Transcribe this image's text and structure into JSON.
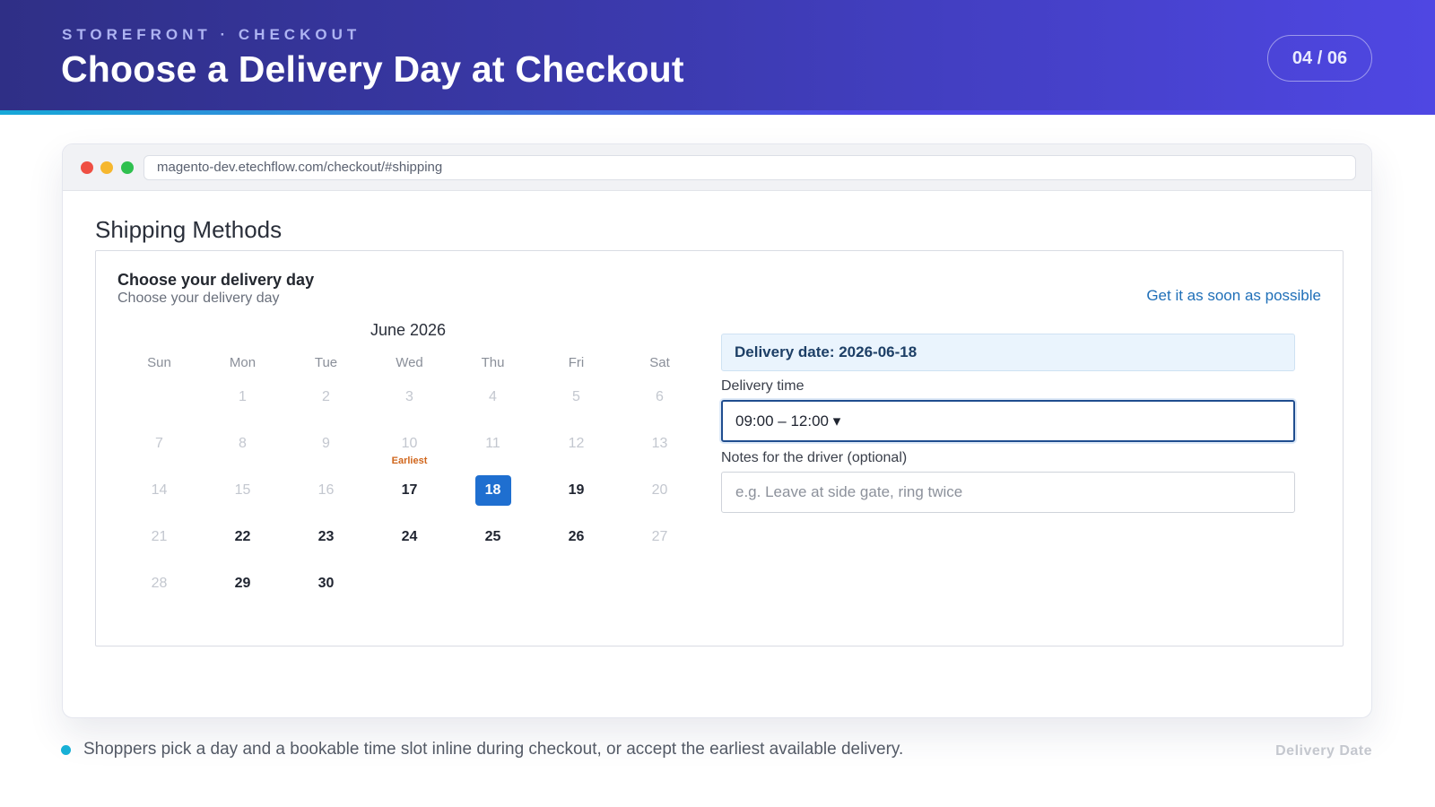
{
  "header": {
    "eyebrow": "STOREFRONT · CHECKOUT",
    "title": "Choose a Delivery Day at Checkout",
    "page_counter": "04 / 06"
  },
  "browser": {
    "url": "magento-dev.etechflow.com/checkout/#shipping"
  },
  "checkout": {
    "section_title": "Shipping Methods",
    "panel_title": "Choose your delivery day",
    "panel_subtitle": "Choose your delivery day",
    "asap_link": "Get it as soon as possible",
    "calendar": {
      "month": "June 2026",
      "weekdays": [
        "Sun",
        "Mon",
        "Tue",
        "Wed",
        "Thu",
        "Fri",
        "Sat"
      ],
      "earliest_label": "Earliest",
      "weeks": [
        [
          null,
          {
            "d": "1",
            "s": "off"
          },
          {
            "d": "2",
            "s": "off"
          },
          {
            "d": "3",
            "s": "off"
          },
          {
            "d": "4",
            "s": "off"
          },
          {
            "d": "5",
            "s": "off"
          },
          {
            "d": "6",
            "s": "off"
          }
        ],
        [
          {
            "d": "7",
            "s": "off"
          },
          {
            "d": "8",
            "s": "off"
          },
          {
            "d": "9",
            "s": "off"
          },
          {
            "d": "10",
            "s": "off",
            "earliest": true
          },
          {
            "d": "11",
            "s": "off"
          },
          {
            "d": "12",
            "s": "off"
          },
          {
            "d": "13",
            "s": "off"
          }
        ],
        [
          {
            "d": "14",
            "s": "off"
          },
          {
            "d": "15",
            "s": "off"
          },
          {
            "d": "16",
            "s": "off"
          },
          {
            "d": "17",
            "s": "avail"
          },
          {
            "d": "18",
            "s": "selected"
          },
          {
            "d": "19",
            "s": "avail"
          },
          {
            "d": "20",
            "s": "off"
          }
        ],
        [
          {
            "d": "21",
            "s": "off"
          },
          {
            "d": "22",
            "s": "avail"
          },
          {
            "d": "23",
            "s": "avail"
          },
          {
            "d": "24",
            "s": "avail"
          },
          {
            "d": "25",
            "s": "avail"
          },
          {
            "d": "26",
            "s": "avail"
          },
          {
            "d": "27",
            "s": "off"
          }
        ],
        [
          {
            "d": "28",
            "s": "off"
          },
          {
            "d": "29",
            "s": "avail"
          },
          {
            "d": "30",
            "s": "avail"
          },
          null,
          null,
          null,
          null
        ]
      ]
    },
    "delivery_date_label": "Delivery date: 2026-06-18",
    "delivery_time_label": "Delivery time",
    "delivery_time_value": "09:00 – 12:00 ▾",
    "notes_label": "Notes for the driver (optional)",
    "notes_placeholder": "e.g. Leave at side gate, ring twice"
  },
  "footer": {
    "text": "Shoppers pick a day and a bookable time slot inline during checkout, or accept the earliest available delivery.",
    "tag": "Delivery Date"
  },
  "colors": {
    "header_start": "#2f2f86",
    "header_end": "#4f47e3",
    "accent_cyan": "#17b0d6",
    "selected_day": "#1f6fd0",
    "link_blue": "#1f6fb8",
    "earliest_orange": "#d0661c"
  }
}
